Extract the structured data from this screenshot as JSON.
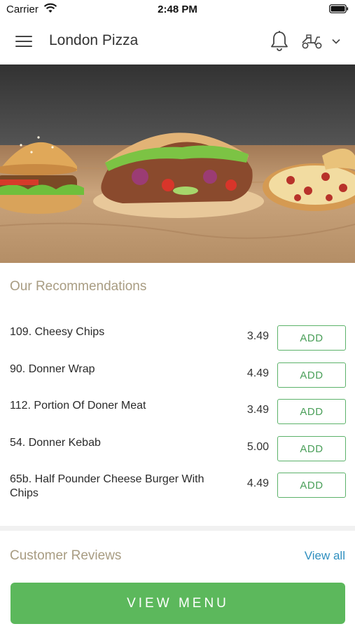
{
  "status_bar": {
    "carrier": "Carrier",
    "time": "2:48 PM"
  },
  "app_bar": {
    "title": "London Pizza",
    "menu_icon": "hamburger-menu-icon",
    "notification_icon": "bell-icon",
    "delivery_icon": "scooter-icon",
    "dropdown_icon": "chevron-down-icon"
  },
  "hero": {
    "image": "food-banner-burger-kebab-pizza"
  },
  "recommendations": {
    "title": "Our Recommendations",
    "items": [
      {
        "name": "109. Cheesy Chips",
        "price": "3.49",
        "button": "ADD"
      },
      {
        "name": "90. Donner Wrap",
        "price": "4.49",
        "button": "ADD"
      },
      {
        "name": "112. Portion Of Doner Meat",
        "price": "3.49",
        "button": "ADD"
      },
      {
        "name": "54. Donner Kebab",
        "price": "5.00",
        "button": "ADD"
      },
      {
        "name": "65b. Half Pounder Cheese Burger With Chips",
        "price": "4.49",
        "button": "ADD"
      }
    ]
  },
  "reviews": {
    "title": "Customer Reviews",
    "view_all": "View all"
  },
  "footer": {
    "view_menu": "VIEW MENU"
  },
  "colors": {
    "accent_green": "#5cb85c",
    "section_title": "#a89c82",
    "link_blue": "#2f8fbf"
  }
}
